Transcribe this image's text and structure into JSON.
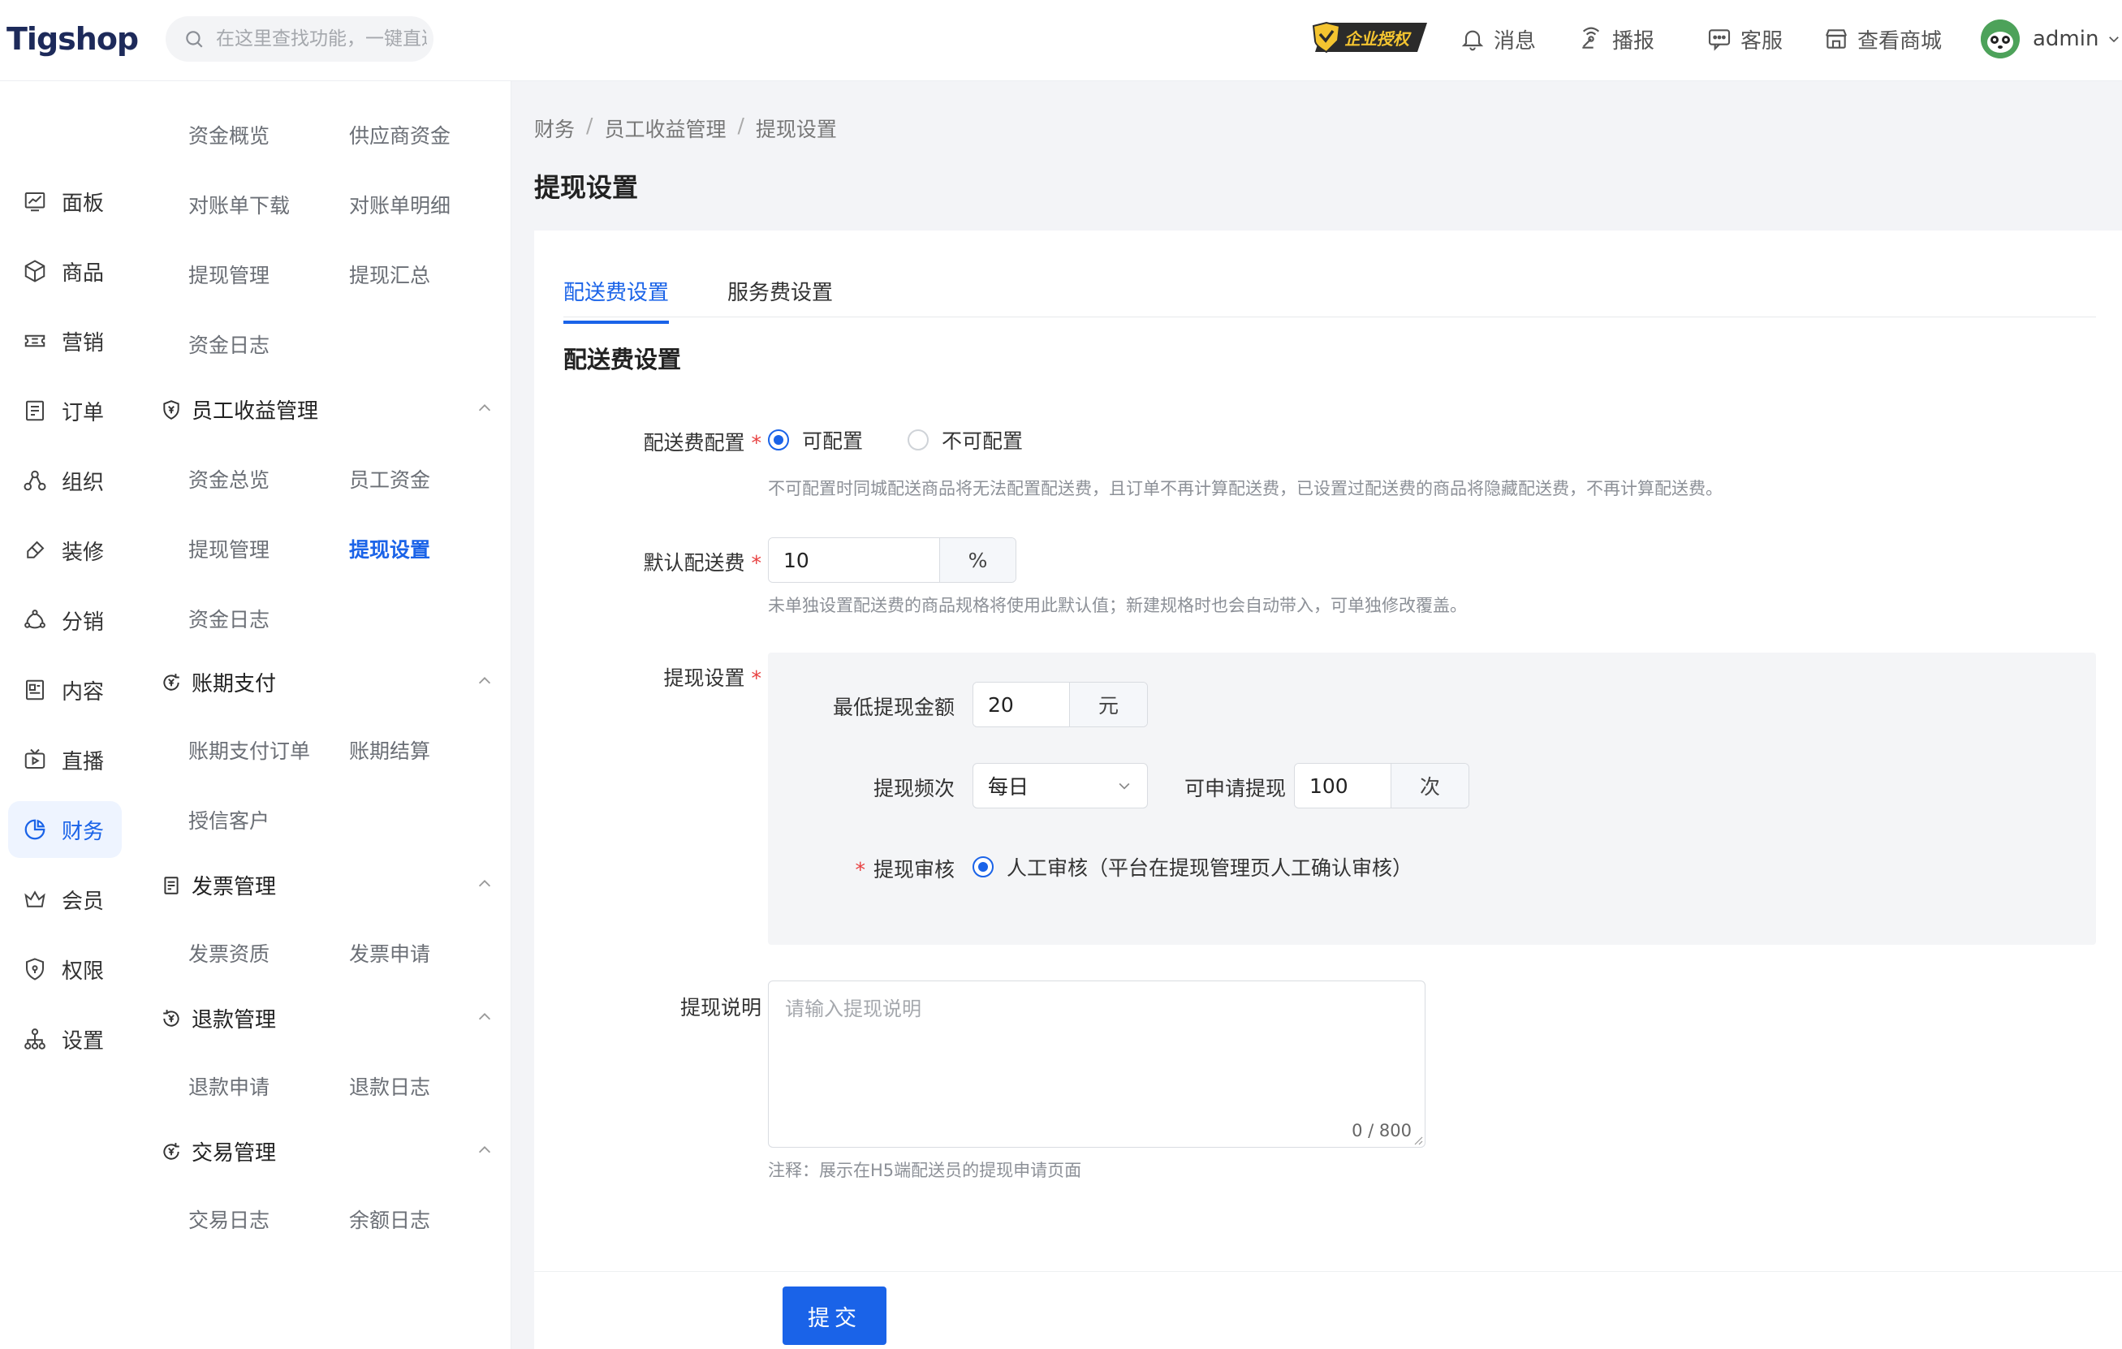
{
  "header": {
    "brand": "Tigshop",
    "search_placeholder": "在这里查找功能，一键直达",
    "badge": "企业授权",
    "nav": [
      "消息",
      "播报",
      "客服",
      "查看商城"
    ],
    "user": "admin"
  },
  "leftnav": [
    "面板",
    "商品",
    "营销",
    "订单",
    "组织",
    "装修",
    "分销",
    "内容",
    "直播",
    "财务",
    "会员",
    "权限",
    "设置"
  ],
  "leftnav_active": "财务",
  "subnav": {
    "top_links": [
      "资金概览",
      "供应商资金",
      "对账单下载",
      "对账单明细",
      "提现管理",
      "提现汇总",
      "资金日志"
    ],
    "groups": [
      {
        "title": "员工收益管理",
        "links": [
          "资金总览",
          "员工资金",
          "提现管理",
          "提现设置",
          "资金日志"
        ]
      },
      {
        "title": "账期支付",
        "links": [
          "账期支付订单",
          "账期结算",
          "授信客户"
        ]
      },
      {
        "title": "发票管理",
        "links": [
          "发票资质",
          "发票申请"
        ]
      },
      {
        "title": "退款管理",
        "links": [
          "退款申请",
          "退款日志"
        ]
      },
      {
        "title": "交易管理",
        "links": [
          "交易日志",
          "余额日志"
        ]
      }
    ],
    "active": "提现设置"
  },
  "breadcrumb": [
    "财务",
    "员工收益管理",
    "提现设置"
  ],
  "page_title": "提现设置",
  "tabs": [
    "配送费设置",
    "服务费设置"
  ],
  "active_tab": "配送费设置",
  "form": {
    "section_title": "配送费设置",
    "fee_config": {
      "label": "配送费配置",
      "options": [
        "可配置",
        "不可配置"
      ],
      "selected": "可配置",
      "hint": "不可配置时同城配送商品将无法配置配送费，且订单不再计算配送费，已设置过配送费的商品将隐藏配送费，不再计算配送费。"
    },
    "default_fee": {
      "label": "默认配送费",
      "value": "10",
      "unit": "%",
      "hint": "未单独设置配送费的商品规格将使用此默认值；新建规格时也会自动带入，可单独修改覆盖。"
    },
    "withdraw": {
      "label": "提现设置",
      "min_amount_label": "最低提现金额",
      "min_amount": "20",
      "min_amount_unit": "元",
      "frequency_label": "提现频次",
      "frequency": "每日",
      "times_label": "可申请提现",
      "times": "100",
      "times_unit": "次",
      "audit_label": "提现审核",
      "audit_option": "人工审核（平台在提现管理页人工确认审核）"
    },
    "description": {
      "label": "提现说明",
      "placeholder": "请输入提现说明",
      "counter": "0 / 800",
      "hint": "注释：展示在H5端配送员的提现申请页面"
    },
    "submit": "提交"
  }
}
